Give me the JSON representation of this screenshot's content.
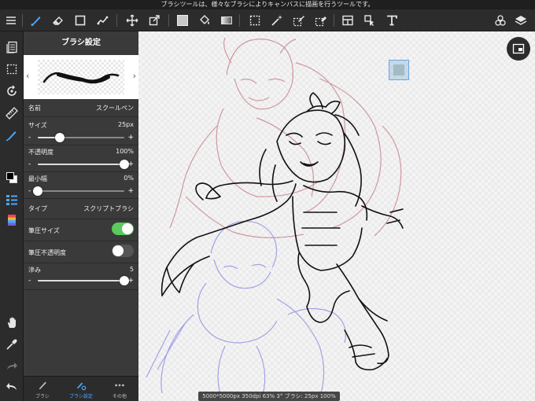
{
  "hint": "ブラシツールは、様々なブラシによりキャンバスに描画を行うツールです。",
  "colors": {
    "accent": "#4aa8ff",
    "toggle_on": "#5cc95c",
    "toggle_off": "#555555",
    "sketch_red": "#c98a92",
    "sketch_blue": "#9a9ae6"
  },
  "toolbar": {
    "menu_icon": "hamburger-icon",
    "tools": [
      "brush-icon",
      "eraser-icon",
      "rectangle-icon",
      "fill-tool-icon",
      "move-icon",
      "transform-icon",
      "color-swatch-icon",
      "bucket-icon",
      "gradient-icon",
      "select-rect-icon",
      "magic-wand-icon",
      "select-pen-icon",
      "select-erase-icon",
      "frame-icon",
      "operation-icon",
      "text-icon",
      "material-icon",
      "layers-icon"
    ]
  },
  "left_bar": {
    "items": [
      "pages-icon",
      "selection-icon",
      "rotate-icon",
      "ruler-icon",
      "brush-settings-icon",
      "color-swap-icon",
      "layer-list-icon",
      "palette-icon",
      "hand-icon",
      "eyedropper-icon",
      "redo-icon",
      "undo-icon"
    ]
  },
  "panel": {
    "title": "ブラシ設定",
    "name_label": "名前",
    "name_value": "スクールペン",
    "size_label": "サイズ",
    "size_value": "25px",
    "size_level": 0.25,
    "opacity_label": "不透明度",
    "opacity_value": "100%",
    "opacity_level": 1.0,
    "min_width_label": "最小幅",
    "min_width_value": "0%",
    "min_width_level": 0.0,
    "type_label": "タイプ",
    "type_value": "スクリプトブラシ",
    "pressure_size_label": "筆圧サイズ",
    "pressure_size_on": true,
    "pressure_opacity_label": "筆圧不透明度",
    "pressure_opacity_on": false,
    "blur_label": "滲み",
    "blur_value": "5",
    "blur_level": 1.0,
    "minus": "-",
    "plus": "+",
    "prev": "‹",
    "next": "›"
  },
  "panel_tabs": [
    {
      "label": "ブラシ",
      "icon": "brush-icon"
    },
    {
      "label": "ブラシ設定",
      "icon": "brush-settings-icon"
    },
    {
      "label": "その他",
      "icon": "more-icon"
    }
  ],
  "status": "5000*5000px 350dpi 63% 3° ブラシ: 25px 100%"
}
